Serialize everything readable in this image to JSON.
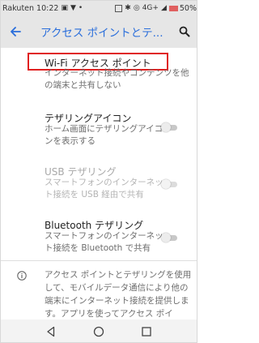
{
  "status_bar": {
    "carrier": "Rakuten",
    "time": "10:22",
    "network": "4G+",
    "battery": "50%"
  },
  "app_bar": {
    "title": "アクセス ポイントとテ..."
  },
  "items": [
    {
      "title": "Wi-Fi アクセス ポイント",
      "summary": "インターネット接続やコンテンツを他の端末と共有しない"
    },
    {
      "title": "テザリングアイコン",
      "summary": "ホーム画面にテザリングアイコンを表示する",
      "toggle": "off"
    },
    {
      "title": "USB テザリング",
      "summary": "スマートフォンのインターネット接続を USB 経由で共有",
      "toggle": "off",
      "disabled": true
    },
    {
      "title": "Bluetooth テザリング",
      "summary": "スマートフォンのインターネット接続を Bluetooth で共有",
      "toggle": "off"
    }
  ],
  "info": {
    "text": "アクセス ポイントとテザリングを使用して、モバイルデータ通信により他の端末にインターネット接続を提供します。アプリを使ってアクセス ポイ"
  },
  "colors": {
    "accent": "#2a6edb",
    "highlight": "#e02020"
  }
}
